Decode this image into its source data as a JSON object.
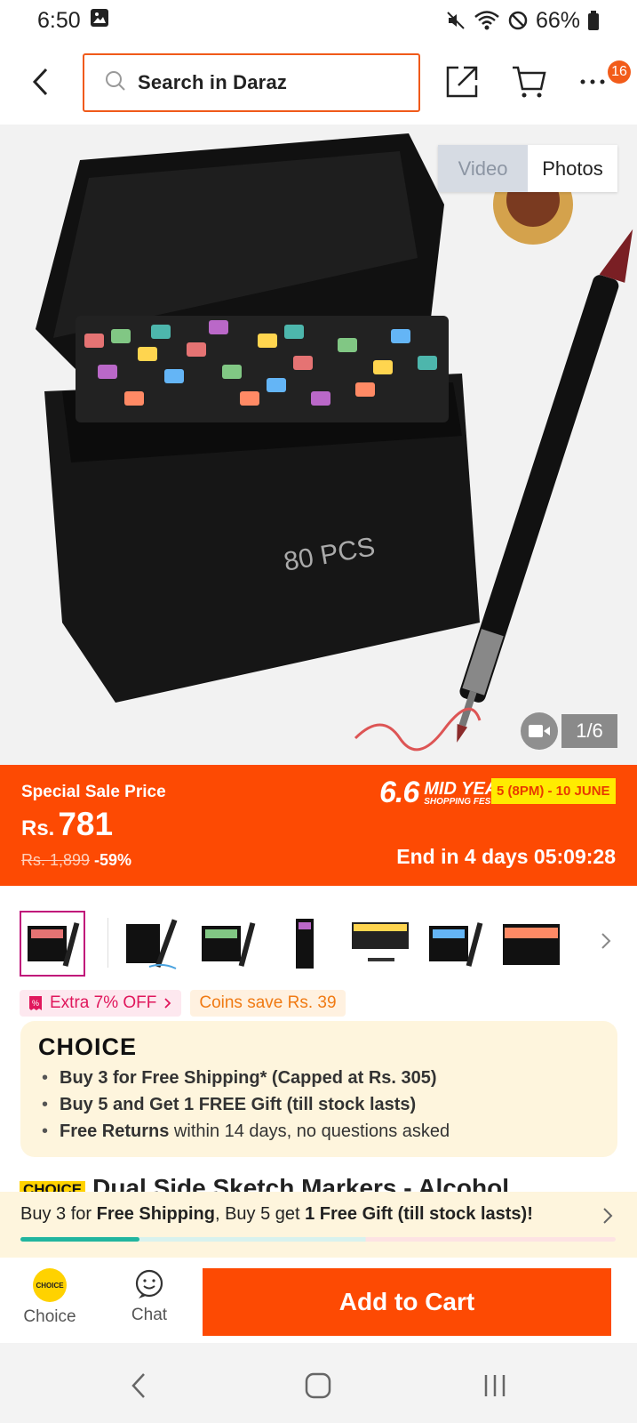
{
  "status_bar": {
    "time": "6:50",
    "battery": "66%",
    "icons": [
      "image-icon",
      "mute-icon",
      "wifi-icon",
      "do-not-disturb-icon",
      "battery-icon"
    ]
  },
  "header": {
    "search_placeholder": "Search in Daraz",
    "more_badge": "16",
    "icons": [
      "back-icon",
      "search-icon",
      "share-icon",
      "cart-icon",
      "more-icon"
    ]
  },
  "hero": {
    "media_tabs": [
      "Video",
      "Photos"
    ],
    "selected_tab": "Photos",
    "image_counter": "1/6",
    "product_image_text": "80 PCS"
  },
  "sale": {
    "label": "Special Sale Price",
    "currency": "Rs.",
    "price": "781",
    "original_price": "Rs. 1,899",
    "discount": "-59%",
    "campaign_big": "6.6",
    "campaign_line1": "MID YEAR",
    "campaign_line2": "SHOPPING FEST!",
    "campaign_date": "5 (8PM) - 10 JUNE",
    "countdown": "End in 4 days 05:09:28",
    "colors": {
      "banner": "#fd4a03",
      "date_bg": "#ffeb00"
    }
  },
  "thumbnails": {
    "count": 7,
    "selected_index": 0
  },
  "promo_tags": {
    "extra": "Extra 7% OFF",
    "coins": "Coins save Rs. 39"
  },
  "choice": {
    "logo": "CHOICE",
    "item1_pre": "Buy 3 for  Free Shipping* (Capped at Rs. 305)",
    "item2_pre": "Buy 5 and Get 1 FREE Gift (till stock lasts)",
    "item3_bold": "Free Returns",
    "item3_rest": " within 14 days, no questions asked"
  },
  "product_title": {
    "chip": "CHOICE",
    "text": "Dual Side Sketch Markers - Alcohol"
  },
  "shipping_bar": {
    "p1": "Buy 3 for ",
    "b1": "Free Shipping",
    "p2": ", Buy 5 get ",
    "b2": "1 Free Gift (till stock lasts)!",
    "progress": 0.2,
    "colors": {
      "fill": "#21b59f"
    }
  },
  "action_bar": {
    "choice_label": "Choice",
    "coin_text": "CHOICE",
    "chat_label": "Chat",
    "add_to_cart": "Add to Cart"
  }
}
